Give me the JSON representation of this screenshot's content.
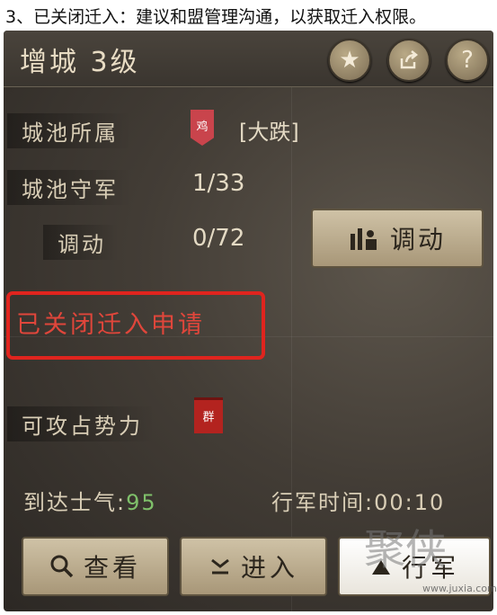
{
  "caption": "3、已关闭迁入：建议和盟管理沟通，以获取迁入权限。",
  "panel": {
    "title": "增城 3级",
    "header_buttons": [
      "star-icon",
      "share-icon",
      "help-icon"
    ],
    "help_glyph": "?",
    "rows": {
      "owner_label": "城池所属",
      "owner_banner_char": "鸡",
      "owner_name": "[大跌]",
      "garrison_label": "城池守军",
      "garrison_value": "1/33",
      "mobilize_label": "调动",
      "mobilize_value": "0/72"
    },
    "mobilize_button": "调动",
    "closed_notice": "已关闭迁入申请",
    "attackable_label": "可攻占势力",
    "attackable_banner_char": "群",
    "morale_label": "到达士气:",
    "morale_value": "95",
    "march_label": "行军时间:",
    "march_value": "00:10",
    "actions": {
      "view": "查看",
      "enter": "进入",
      "march": "行军"
    }
  },
  "watermark": {
    "text": "聚侠",
    "url": "www.juxia.com"
  },
  "colors": {
    "notice_red": "#e0463b",
    "box_red": "#e0241e",
    "morale_green": "#7fc06a"
  }
}
